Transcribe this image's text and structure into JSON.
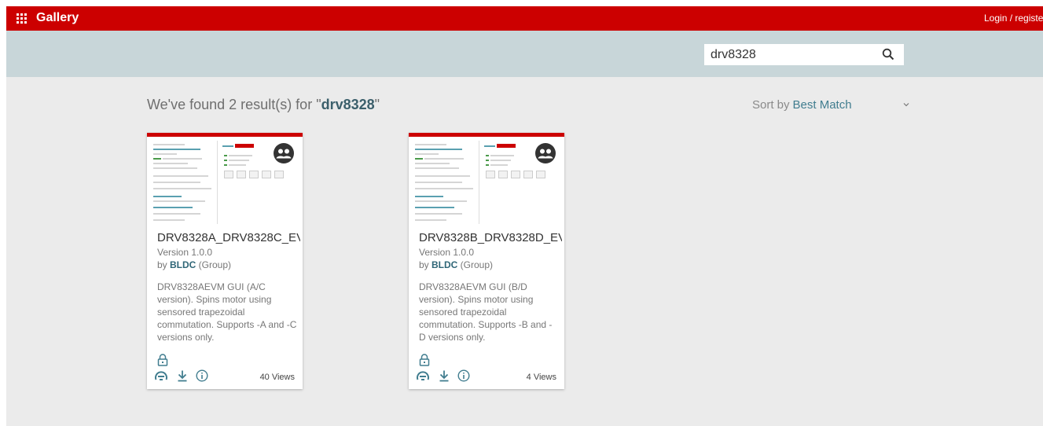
{
  "header": {
    "app_title": "Gallery",
    "login_text": "Login / registe"
  },
  "search": {
    "value": "drv8328",
    "icon": "search-icon"
  },
  "results": {
    "prefix": "We've found 2 result(s) for \"",
    "query": "drv8328",
    "suffix": "\""
  },
  "sort": {
    "label": "Sort by",
    "value": "Best Match"
  },
  "cards": [
    {
      "name": "DRV8328A_DRV8328C_EV",
      "version": "Version 1.0.0",
      "by_prefix": "by ",
      "group": "BLDC",
      "group_suffix": " (Group)",
      "description": "DRV8328AEVM GUI (A/C version). Spins motor using sensored trapezoidal commutation. Supports -A and -C versions only.",
      "views": "40 Views"
    },
    {
      "name": "DRV8328B_DRV8328D_EV",
      "version": "Version 1.0.0",
      "by_prefix": "by ",
      "group": "BLDC",
      "group_suffix": " (Group)",
      "description": "DRV8328AEVM GUI (B/D version). Spins motor using sensored trapezoidal commutation. Supports -B and -D versions only.",
      "views": "4 Views"
    }
  ],
  "colors": {
    "header_red": "#cc0000",
    "search_band": "#c8d6d9",
    "background": "#ebebeb",
    "accent_teal": "#417d8f"
  }
}
